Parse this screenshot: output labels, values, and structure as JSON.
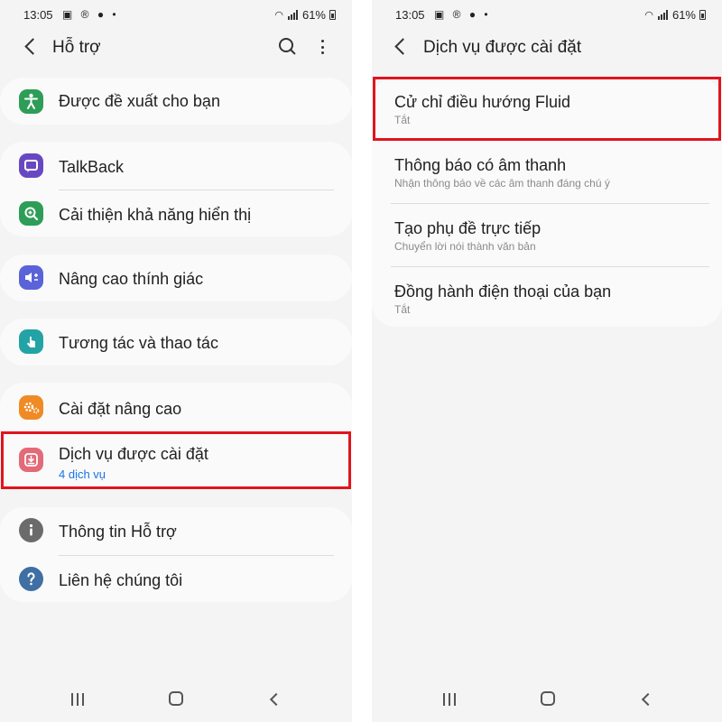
{
  "status_bar": {
    "time": "13:05",
    "notification_icons": [
      "image-icon",
      "r-icon",
      "bulb-icon",
      "dot-icon"
    ],
    "battery": "61%"
  },
  "left_screen": {
    "title": "Hỗ trợ",
    "groups": [
      {
        "items": [
          {
            "label": "Được đề xuất cho bạn",
            "icon": "accessibility-icon",
            "color": "#2e9d57"
          }
        ]
      },
      {
        "items": [
          {
            "label": "TalkBack",
            "icon": "talkback-icon",
            "color": "#6848c2"
          },
          {
            "label": "Cải thiện khả năng hiển thị",
            "icon": "visibility-icon",
            "color": "#2e9d57"
          }
        ]
      },
      {
        "items": [
          {
            "label": "Nâng cao thính giác",
            "icon": "hearing-icon",
            "color": "#5a63d8"
          }
        ]
      },
      {
        "items": [
          {
            "label": "Tương tác và thao tác",
            "icon": "interaction-icon",
            "color": "#23a3a5"
          }
        ]
      },
      {
        "items": [
          {
            "label": "Cài đặt nâng cao",
            "icon": "advanced-settings-icon",
            "color": "#f08a24"
          },
          {
            "label": "Dịch vụ được cài đặt",
            "subtitle": "4 dịch vụ",
            "icon": "installed-services-icon",
            "color": "#e36a78"
          }
        ]
      },
      {
        "items": [
          {
            "label": "Thông tin Hỗ trợ",
            "icon": "info-icon",
            "color": "#6b6b6b"
          },
          {
            "label": "Liên hệ chúng tôi",
            "icon": "help-icon",
            "color": "#3f6fa3"
          }
        ]
      }
    ]
  },
  "right_screen": {
    "title": "Dịch vụ được cài đặt",
    "items": [
      {
        "title": "Cử chỉ điều hướng Fluid",
        "subtitle": "Tắt"
      },
      {
        "title": "Thông báo có âm thanh",
        "subtitle": "Nhận thông báo về các âm thanh đáng chú ý"
      },
      {
        "title": "Tạo phụ đề trực tiếp",
        "subtitle": "Chuyển lời nói thành văn bản"
      },
      {
        "title": "Đồng hành điện thoại của bạn",
        "subtitle": "Tắt"
      }
    ]
  },
  "highlight_color": "#e0141e",
  "subtitle_accent_color": "#1a73e8"
}
